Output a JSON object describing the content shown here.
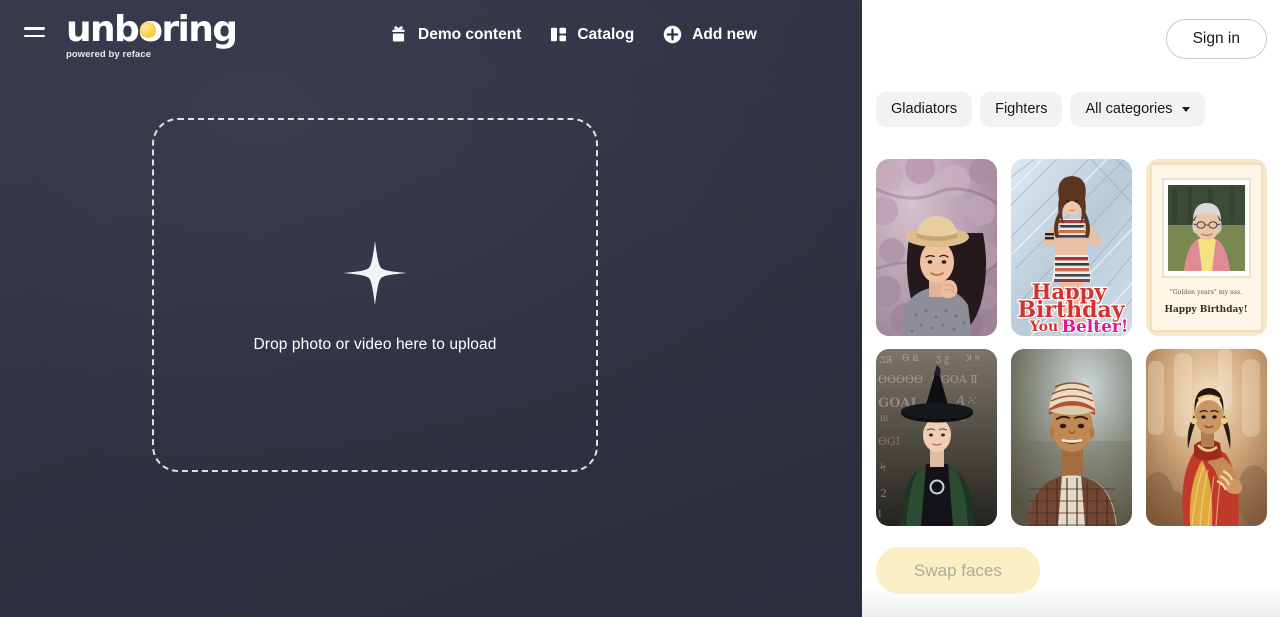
{
  "brand": {
    "name": "unboring",
    "tagline": "powered by reface",
    "accent_color": "#fdd34f",
    "menu_icon": "hamburger-icon"
  },
  "nav": {
    "items": [
      {
        "label": "Demo content",
        "icon": "gift-icon"
      },
      {
        "label": "Catalog",
        "icon": "catalog-grid-icon"
      },
      {
        "label": "Add new",
        "icon": "plus-circle-icon"
      }
    ]
  },
  "dropzone": {
    "label": "Drop photo or video here to upload",
    "icon": "plus-icon"
  },
  "account": {
    "sign_in_label": "Sign in"
  },
  "filters": {
    "chips": [
      {
        "label": "Gladiators",
        "has_caret": false
      },
      {
        "label": "Fighters",
        "has_caret": false
      },
      {
        "label": "All categories",
        "has_caret": true
      }
    ]
  },
  "catalog": {
    "items": [
      {
        "name": "woman-in-straw-hat-cherry-blossom"
      },
      {
        "name": "happy-birthday-you-belter-card",
        "caption_line1": "Happy",
        "caption_line2": "Birthday",
        "caption_line3a": "You",
        "caption_line3b": "Belter!"
      },
      {
        "name": "golden-years-birthday-card",
        "caption_line1": "\"Golden years\" my ass.",
        "caption_line2": "Happy Birthday!"
      },
      {
        "name": "witch-professor-in-black-hat"
      },
      {
        "name": "young-man-with-turban-smiling"
      },
      {
        "name": "dancer-in-golden-saree"
      }
    ]
  },
  "actions": {
    "swap_faces_label": "Swap faces"
  },
  "colors": {
    "panel_dark": "#2f3344",
    "panel_light": "#ffffff",
    "chip_bg": "#f2f2f2",
    "swap_bg": "#fbeec4",
    "swap_text": "#adaaa2"
  }
}
